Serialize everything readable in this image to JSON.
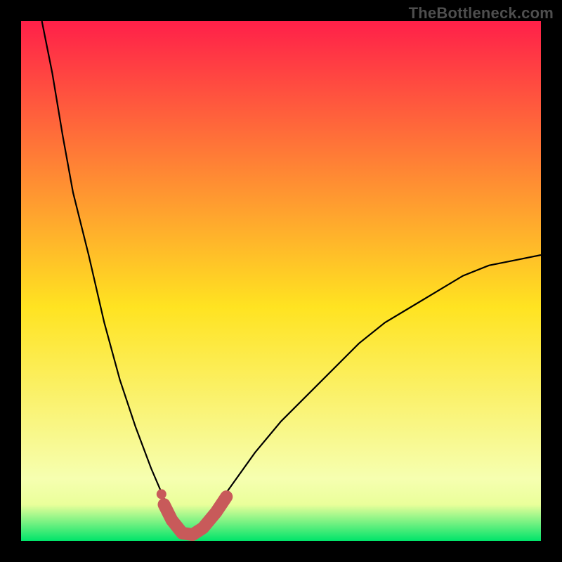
{
  "watermark": "TheBottleneck.com",
  "colors": {
    "gradient_top": "#ff2049",
    "gradient_mid": "#ffe321",
    "gradient_green_band": "#eaff9a",
    "gradient_bottom": "#00e46a",
    "curve": "#000000",
    "marker": "#c85a5a",
    "frame": "#000000"
  },
  "chart_data": {
    "type": "line",
    "title": "",
    "xlabel": "",
    "ylabel": "",
    "xlim": [
      0,
      100
    ],
    "ylim": [
      0,
      100
    ],
    "legend": false,
    "grid": false,
    "curve_comment": "V-shaped curve. y ≈ percentage mismatch; minimum at x≈32 where y≈0. Left arm rises steeply past 100; right arm rises more gently to ≈55 at x=100.",
    "left_arm": [
      {
        "x": 4,
        "y": 100
      },
      {
        "x": 6,
        "y": 90
      },
      {
        "x": 8,
        "y": 78
      },
      {
        "x": 10,
        "y": 67
      },
      {
        "x": 13,
        "y": 55
      },
      {
        "x": 16,
        "y": 42
      },
      {
        "x": 19,
        "y": 31
      },
      {
        "x": 22,
        "y": 22
      },
      {
        "x": 25,
        "y": 14
      },
      {
        "x": 28,
        "y": 7
      },
      {
        "x": 30,
        "y": 3
      },
      {
        "x": 32,
        "y": 0.8
      }
    ],
    "right_arm": [
      {
        "x": 32,
        "y": 0.8
      },
      {
        "x": 34,
        "y": 2
      },
      {
        "x": 37,
        "y": 6
      },
      {
        "x": 40,
        "y": 10
      },
      {
        "x": 45,
        "y": 17
      },
      {
        "x": 50,
        "y": 23
      },
      {
        "x": 55,
        "y": 28
      },
      {
        "x": 60,
        "y": 33
      },
      {
        "x": 65,
        "y": 38
      },
      {
        "x": 70,
        "y": 42
      },
      {
        "x": 75,
        "y": 45
      },
      {
        "x": 80,
        "y": 48
      },
      {
        "x": 85,
        "y": 51
      },
      {
        "x": 90,
        "y": 53
      },
      {
        "x": 95,
        "y": 54
      },
      {
        "x": 100,
        "y": 55
      }
    ],
    "highlight_band": {
      "comment": "Thick salmon-colored band along the bottom of the V shape, x≈27..40, y≈0..7",
      "points": [
        {
          "x": 27.5,
          "y": 7
        },
        {
          "x": 29,
          "y": 4
        },
        {
          "x": 31,
          "y": 1.5
        },
        {
          "x": 33,
          "y": 1.2
        },
        {
          "x": 35,
          "y": 2.5
        },
        {
          "x": 37.5,
          "y": 5.5
        },
        {
          "x": 39.5,
          "y": 8.5
        }
      ]
    },
    "highlight_dot": {
      "x": 27,
      "y": 9
    }
  }
}
